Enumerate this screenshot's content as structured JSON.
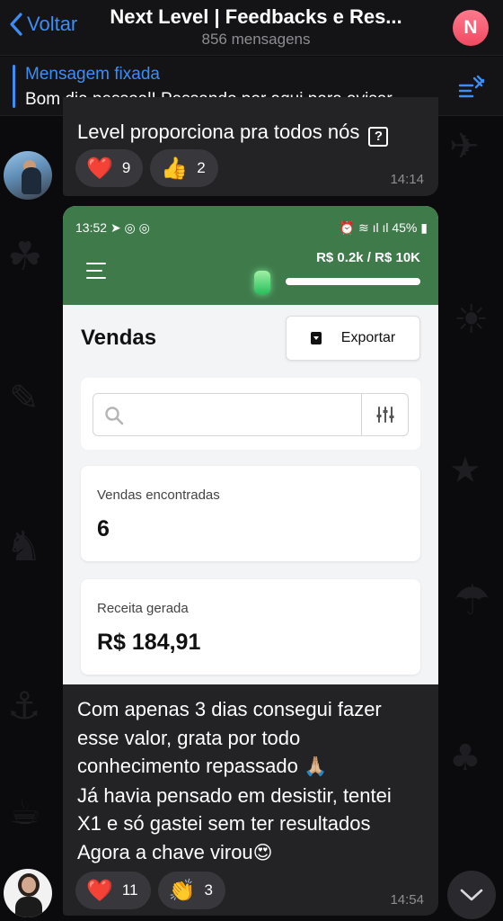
{
  "header": {
    "back_label": "Voltar",
    "title": "Next Level | Feedbacks e Res...",
    "subtitle": "856 mensagens",
    "avatar_letter": "N",
    "avatar_color": "#f04a62"
  },
  "pinned": {
    "title": "Mensagem fixada",
    "text": "Bom dia pessoal! Passando por aqui para avisar..."
  },
  "messages": [
    {
      "text": "Level proporciona pra todos nós",
      "text_suffix_icon": "?",
      "reactions": [
        {
          "emoji": "❤️",
          "count": "9"
        },
        {
          "emoji": "👍",
          "count": "2"
        }
      ],
      "time": "14:14"
    },
    {
      "screenshot": {
        "status_time": "13:52",
        "status_right": "45%",
        "progress_label": "R$ 0.2k / R$ 10K",
        "progress_fraction": 0.02,
        "page_title": "Vendas",
        "export_label": "Exportar",
        "search_placeholder": "",
        "stats": [
          {
            "label": "Vendas encontradas",
            "value": "6"
          },
          {
            "label": "Receita gerada",
            "value": "R$ 184,91"
          }
        ]
      },
      "text_lines": [
        "Com apenas 3 dias consegui fazer",
        "esse valor, grata por todo",
        "conhecimento repassado",
        "Já havia pensado em desistir, tentei",
        "X1 e só gastei sem ter resultados",
        "Agora a chave virou"
      ],
      "line3_emoji": "🙏🏼",
      "line6_emoji": "😍",
      "reactions": [
        {
          "emoji": "❤️",
          "count": "11"
        },
        {
          "emoji": "👏",
          "count": "3"
        }
      ],
      "time": "14:54"
    }
  ],
  "colors": {
    "accent": "#3d8df5",
    "bubble": "#232326",
    "app_green": "#3f7a4b"
  },
  "icons": {
    "back": "chevron-left-icon",
    "pinned": "pin-list-icon",
    "scroll_down": "chevron-down-icon"
  }
}
